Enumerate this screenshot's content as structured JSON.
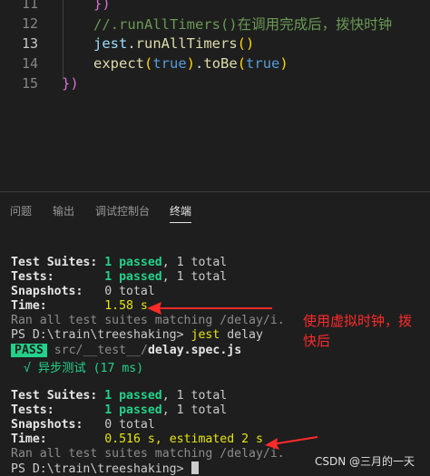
{
  "editor": {
    "lines": [
      {
        "num": "11"
      },
      {
        "num": "12"
      },
      {
        "num": "13"
      },
      {
        "num": "14"
      },
      {
        "num": "15"
      }
    ],
    "line11": {
      "brace": "})"
    },
    "line12": {
      "comment": "//.runAllTimers()在调用完成后，拨快时钟"
    },
    "line13": {
      "obj": "jest",
      "dot": ".",
      "fn": "runAllTimers",
      "paren": "()"
    },
    "line14": {
      "fn1": "expect",
      "p1": "(",
      "val1": "true",
      "p2": ")",
      "dot": ".",
      "fn2": "toBe",
      "p3": "(",
      "val2": "true",
      "p4": ")"
    },
    "line15": {
      "brace": "})"
    }
  },
  "panel": {
    "tabs": [
      {
        "label": "问题"
      },
      {
        "label": "输出"
      },
      {
        "label": "调试控制台"
      },
      {
        "label": "终端"
      }
    ]
  },
  "terminal": {
    "block1": {
      "suites_label": "Test Suites:",
      "suites_passed": "1 passed",
      "suites_total": ", 1 total",
      "tests_label": "Tests:",
      "tests_passed": "1 passed",
      "tests_total": ", 1 total",
      "snap_label": "Snapshots:",
      "snap_value": "0 total",
      "time_label": "Time:",
      "time_value": "1.58 s",
      "ran": "Ran all test suites matching /delay/i."
    },
    "prompt1": {
      "ps": "PS D:\\train\\treeshaking>",
      "cmd": "jest",
      "arg": "delay"
    },
    "pass_badge": "PASS",
    "pass_path_dim": "src/__test__/",
    "pass_file": "delay.spec.js",
    "test_case": "√ 异步测试 (17 ms)",
    "block2": {
      "suites_label": "Test Suites:",
      "suites_passed": "1 passed",
      "suites_total": ", 1 total",
      "tests_label": "Tests:",
      "tests_passed": "1 passed",
      "tests_total": ", 1 total",
      "snap_label": "Snapshots:",
      "snap_value": "0 total",
      "time_label": "Time:",
      "time_value": "0.516 s, estimated 2 s",
      "ran": "Ran all test suites matching /delay/i."
    },
    "prompt2": {
      "ps": "PS D:\\train\\treeshaking>"
    }
  },
  "annotation": {
    "text": "使用虚拟时钟，拨快后"
  },
  "watermark": {
    "text": "CSDN @三月的一天"
  },
  "colors": {
    "annotation": "#ff2a2a",
    "pass_green": "#23d18b"
  }
}
